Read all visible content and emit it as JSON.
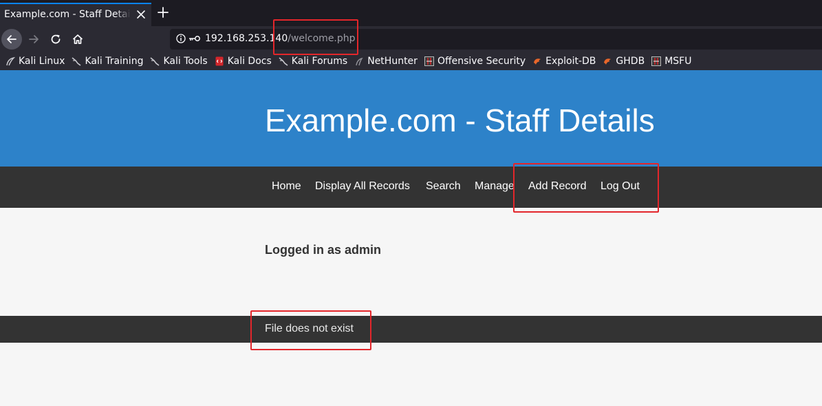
{
  "browser": {
    "tab_title": "Example.com - Staff Details",
    "url_host": "192.168.253.140",
    "url_path": "/welcome.php",
    "bookmarks": [
      {
        "label": "Kali Linux",
        "icon": "kali-dragon-icon"
      },
      {
        "label": "Kali Training",
        "icon": "kali-dragon-icon"
      },
      {
        "label": "Kali Tools",
        "icon": "kali-dragon-icon"
      },
      {
        "label": "Kali Docs",
        "icon": "kali-docs-icon"
      },
      {
        "label": "Kali Forums",
        "icon": "kali-dragon-icon"
      },
      {
        "label": "NetHunter",
        "icon": "kali-dragon-icon"
      },
      {
        "label": "Offensive Security",
        "icon": "offsec-icon"
      },
      {
        "label": "Exploit-DB",
        "icon": "exploitdb-icon"
      },
      {
        "label": "GHDB",
        "icon": "ghdb-icon"
      },
      {
        "label": "MSFU",
        "icon": "offsec-icon"
      }
    ]
  },
  "site": {
    "title": "Example.com - Staff Details",
    "nav": {
      "home": "Home",
      "display_all": "Display All Records",
      "search": "Search",
      "manage": "Manage",
      "add_record": "Add Record",
      "log_out": "Log Out"
    },
    "logged_in": "Logged in as admin",
    "message": "File does not exist"
  },
  "colors": {
    "hero": "#2d82c9",
    "nav_bg": "#333333",
    "annotation": "#e3262b"
  }
}
